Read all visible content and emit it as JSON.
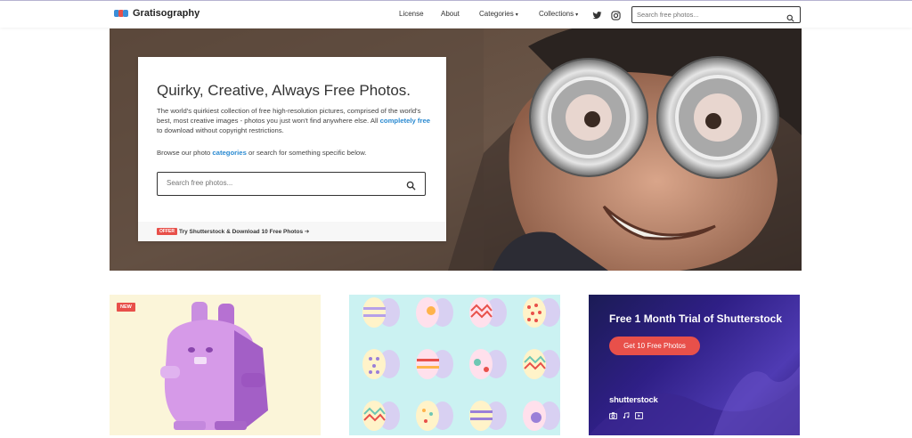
{
  "brand": {
    "name": "Gratisography"
  },
  "nav": {
    "license": "License",
    "about": "About",
    "categories": "Categories",
    "collections": "Collections"
  },
  "search_top": {
    "placeholder": "Search free photos..."
  },
  "hero": {
    "title": "Quirky, Creative, Always Free Photos.",
    "desc_before": "The world's quirkiest collection of free high-resolution pictures, comprised of the world's best, most creative images - photos you just won't find anywhere else. All ",
    "desc_link": "completely free",
    "desc_after": " to download without copyright restrictions.",
    "browse_before": "Browse our photo ",
    "browse_link": "categories",
    "browse_after": " or search for something specific below.",
    "search_placeholder": "Search free photos...",
    "offer_badge": "OFFER",
    "offer_text": "Try Shutterstock & Download 10 Free Photos"
  },
  "cards": {
    "new_badge": "NEW",
    "promo_title": "Free 1 Month Trial of Shutterstock",
    "promo_button": "Get 10 Free Photos",
    "promo_brand": "shutterstock"
  },
  "colors": {
    "accent_red": "#e8504a",
    "link_blue": "#2a8ad1",
    "egg_bg": "#cbf2f2",
    "bunny_bg": "#fbf5d9"
  },
  "icons": [
    "search-icon",
    "twitter-icon",
    "instagram-icon",
    "camera-icon",
    "music-icon",
    "video-icon"
  ]
}
